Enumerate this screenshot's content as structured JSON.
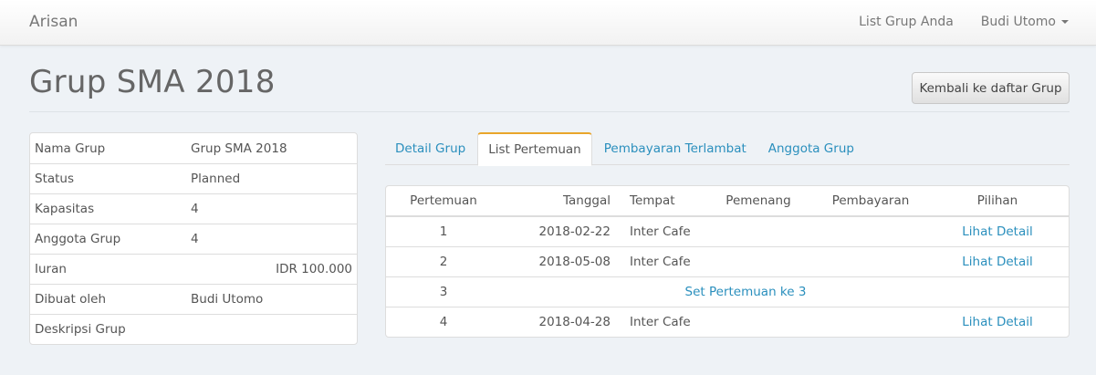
{
  "navbar": {
    "brand": "Arisan",
    "links": [
      "List Grup Anda",
      "Budi Utomo"
    ]
  },
  "header": {
    "title": "Grup SMA 2018",
    "back_button": "Kembali ke daftar Grup"
  },
  "info": [
    {
      "label": "Nama Grup",
      "value": "Grup SMA 2018"
    },
    {
      "label": "Status",
      "value": "Planned"
    },
    {
      "label": "Kapasitas",
      "value": "4"
    },
    {
      "label": "Anggota Grup",
      "value": "4"
    },
    {
      "label": "Iuran",
      "value": "IDR 100.000"
    },
    {
      "label": "Dibuat oleh",
      "value": "Budi Utomo"
    },
    {
      "label": "Deskripsi Grup",
      "value": ""
    }
  ],
  "tabs": [
    {
      "label": "Detail Grup"
    },
    {
      "label": "List Pertemuan"
    },
    {
      "label": "Pembayaran Terlambat"
    },
    {
      "label": "Anggota Grup"
    }
  ],
  "meetings": {
    "columns": [
      "Pertemuan",
      "Tanggal",
      "Tempat",
      "Pemenang",
      "Pembayaran",
      "Pilihan"
    ],
    "rows": [
      {
        "no": "1",
        "date": "2018-02-22",
        "place": "Inter Cafe",
        "action": "Lihat Detail"
      },
      {
        "no": "2",
        "date": "2018-05-08",
        "place": "Inter Cafe",
        "action": "Lihat Detail"
      },
      {
        "no": "3",
        "set_label": "Set Pertemuan ke 3"
      },
      {
        "no": "4",
        "date": "2018-04-28",
        "place": "Inter Cafe",
        "action": "Lihat Detail"
      }
    ]
  },
  "colors": {
    "link": "#2a8fbd",
    "active_tab_accent": "#e9a52b"
  }
}
